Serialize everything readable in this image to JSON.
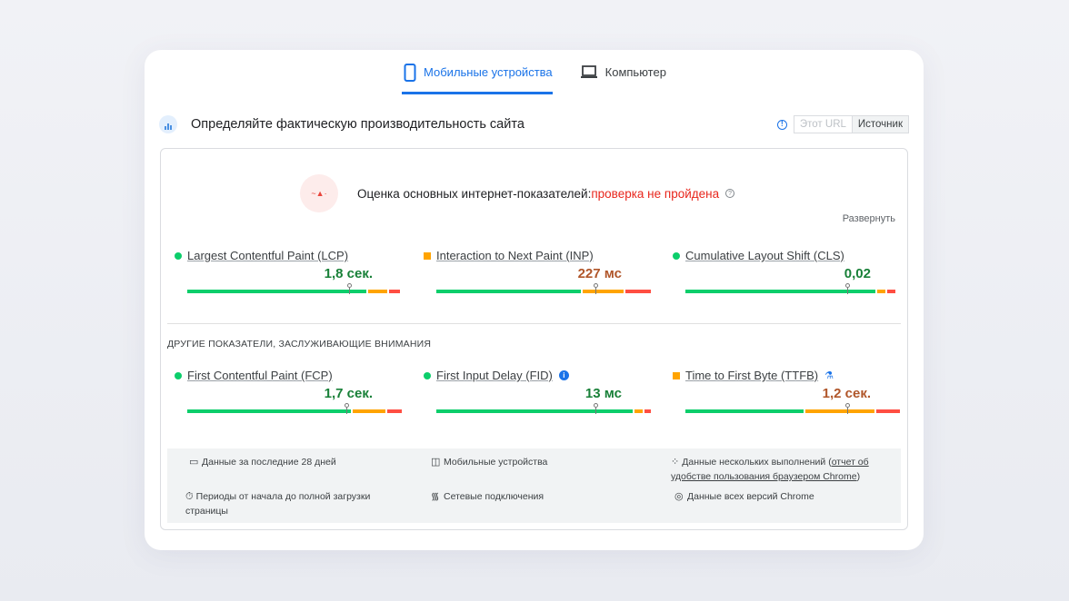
{
  "tabs": [
    {
      "label": "Мобильные устройства",
      "icon": "phone-icon",
      "active": true
    },
    {
      "label": "Компьютер",
      "icon": "laptop-icon",
      "active": false
    }
  ],
  "header": {
    "title": "Определяйте фактическую производительность сайта",
    "toggle": [
      "Этот URL",
      "Источник"
    ],
    "selected": "Источник"
  },
  "assessment": {
    "label": "Оценка основных интернет-показателей:",
    "status": "проверка не пройдена",
    "expand": "Развернуть"
  },
  "colors": {
    "good": "#0cce6b",
    "avg": "#ffa400",
    "poor": "#ff4e42",
    "good_text": "#188038",
    "avg_text": "#b0562a",
    "accent": "#1a73e8"
  },
  "core_metrics": [
    {
      "name": "Largest Contentful Paint (LCP)",
      "value": "1,8 сек.",
      "rating": "good",
      "distribution": [
        83,
        9,
        5
      ],
      "marker": 75
    },
    {
      "name": "Interaction to Next Paint (INP)",
      "value": "227 мс",
      "rating": "avg",
      "distribution": [
        67,
        19,
        12
      ],
      "marker": 74
    },
    {
      "name": "Cumulative Layout Shift (CLS)",
      "value": "0,02",
      "rating": "good",
      "distribution": [
        88,
        4,
        4
      ],
      "marker": 75
    }
  ],
  "other_title": "ДРУГИЕ ПОКАЗАТЕЛИ, ЗАСЛУЖИВАЮЩИЕ ВНИМАНИЯ",
  "other_metrics": [
    {
      "name": "First Contentful Paint (FCP)",
      "value": "1,7 сек.",
      "rating": "good",
      "distribution": [
        76,
        15,
        7
      ],
      "marker": 74
    },
    {
      "name": "First Input Delay (FID)",
      "value": "13 мс",
      "rating": "good",
      "distribution": [
        91,
        4,
        3
      ],
      "marker": 74,
      "extra_icon": "info-icon"
    },
    {
      "name": "Time to First Byte (TTFB)",
      "value": "1,2 сек.",
      "rating": "avg",
      "distribution": [
        55,
        32,
        11
      ],
      "marker": 75,
      "extra_icon": "flask-icon"
    }
  ],
  "footer": {
    "period": "Данные за последние 28 дней",
    "device": "Мобильные устройства",
    "samples_prefix": "Данные нескольких выполнений (",
    "samples_link": "отчет об удобстве пользования браузером Chrome",
    "samples_suffix": ")",
    "duration": "Периоды от начала до полной загрузки страницы",
    "network": "Сетевые подключения",
    "versions": "Данные всех версий Chrome"
  }
}
